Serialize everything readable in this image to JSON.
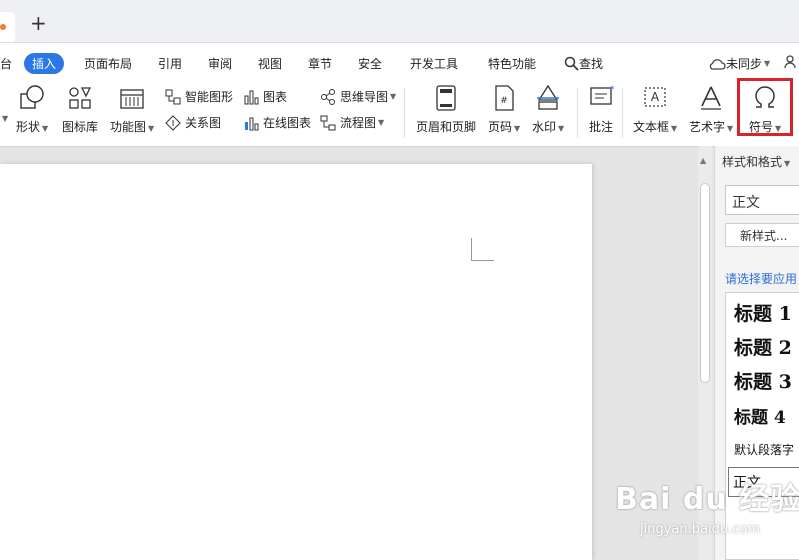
{
  "tabstrip": {
    "new_tab": "+"
  },
  "menu": {
    "items": [
      "台",
      "插入",
      "页面布局",
      "引用",
      "审阅",
      "视图",
      "章节",
      "安全",
      "开发工具",
      "特色功能",
      "查找"
    ],
    "sync": "未同步"
  },
  "ribbon": {
    "shape": "形状",
    "icon_lib": "图标库",
    "func_chart": "功能图",
    "smart_shape": "智能图形",
    "chart": "图表",
    "mindmap": "思维导图",
    "relation": "关系图",
    "online_chart": "在线图表",
    "flowchart": "流程图",
    "header_footer": "页眉和页脚",
    "page_num": "页码",
    "watermark": "水印",
    "comment": "批注",
    "textbox": "文本框",
    "wordart": "艺术字",
    "symbol": "符号",
    "colors": {
      "accent": "#2b78e4",
      "highlight": "#d9232b"
    }
  },
  "panel": {
    "title": "样式和格式",
    "current_style": "正文",
    "new_style": "新样式...",
    "prompt": "请选择要应用",
    "styles": [
      "标题 1",
      "标题 2",
      "标题 3",
      "标题 4",
      "默认段落字",
      "正文"
    ]
  },
  "watermark": {
    "logo": "Bai du 经验",
    "sub": "jingyan.baidu.com"
  }
}
